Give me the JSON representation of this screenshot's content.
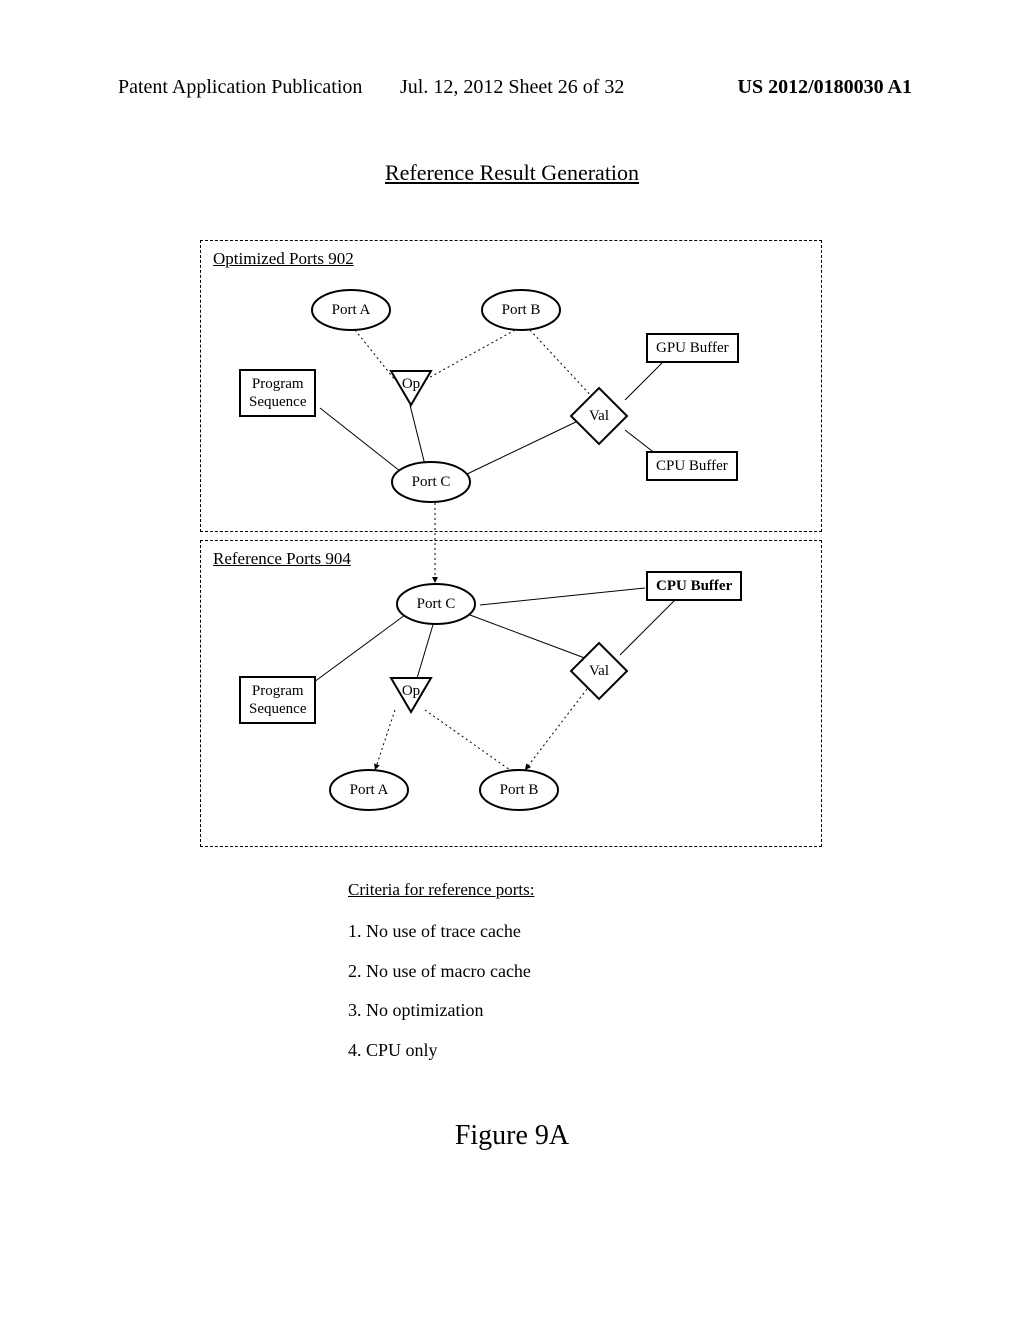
{
  "header": {
    "left": "Patent Application Publication",
    "center": "Jul. 12, 2012  Sheet 26 of 32",
    "right": "US 2012/0180030 A1"
  },
  "title": "Reference Result Generation",
  "panel_a": {
    "title": "Optimized Ports 902",
    "port_a": "Port A",
    "port_b": "Port B",
    "port_c": "Port C",
    "op": "Op",
    "val": "Val",
    "gpu_buffer": "GPU Buffer",
    "cpu_buffer": "CPU Buffer",
    "program_sequence": "Program\nSequence"
  },
  "panel_b": {
    "title": "Reference Ports 904",
    "port_a": "Port A",
    "port_b": "Port B",
    "port_c": "Port C",
    "op": "Op",
    "val": "Val",
    "cpu_buffer": "CPU Buffer",
    "program_sequence": "Program\nSequence"
  },
  "criteria": {
    "title": "Criteria for reference ports:",
    "item1": "1. No use of trace cache",
    "item2": "2. No use of macro cache",
    "item3": "3. No optimization",
    "item4": "4. CPU only"
  },
  "figure_label": "Figure 9A"
}
